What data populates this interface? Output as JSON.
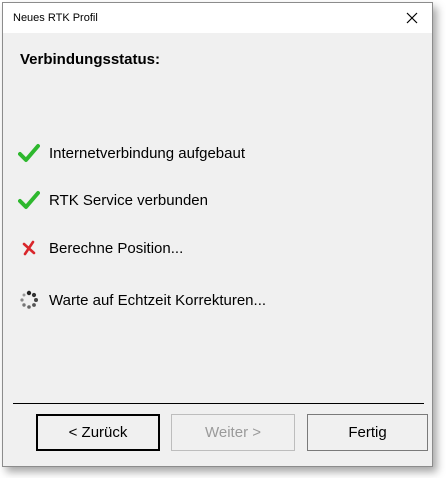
{
  "window": {
    "title": "Neues RTK Profil",
    "close_glyph": "✕"
  },
  "heading": "Verbindungsstatus:",
  "status_items": [
    {
      "label": "Internetverbindung aufgebaut",
      "icon": "checkmark-icon",
      "state": "done",
      "color": "#2eb82e"
    },
    {
      "label": "RTK Service verbunden",
      "icon": "checkmark-icon",
      "state": "done",
      "color": "#2eb82e"
    },
    {
      "label": "Berechne Position...",
      "icon": "cross-icon",
      "state": "in-progress",
      "color": "#d9262b"
    },
    {
      "label": "Warte auf Echtzeit Korrekturen...",
      "icon": "spinner-icon",
      "state": "waiting",
      "color": "#555555"
    }
  ],
  "buttons": {
    "back_label": "< Zurück",
    "next_label": "Weiter >",
    "next_enabled": false,
    "finish_label": "Fertig"
  }
}
